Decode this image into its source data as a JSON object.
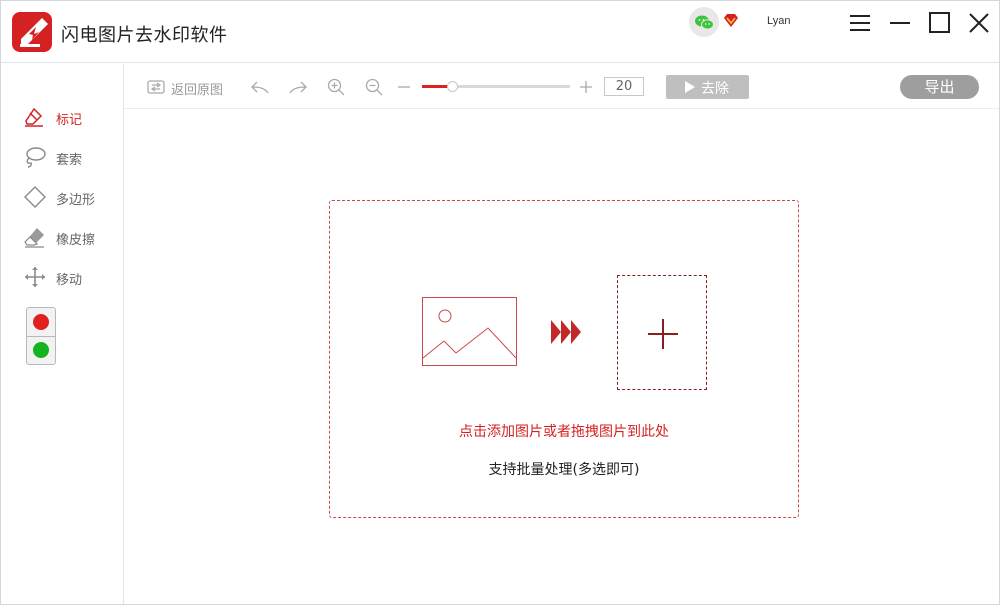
{
  "app": {
    "title": "闪电图片去水印软件",
    "user": "Lyan"
  },
  "sidebar": {
    "tools": [
      {
        "label": "标记",
        "icon": "marker-icon",
        "active": true
      },
      {
        "label": "套索",
        "icon": "lasso-icon",
        "active": false
      },
      {
        "label": "多边形",
        "icon": "polygon-icon",
        "active": false
      },
      {
        "label": "橡皮擦",
        "icon": "eraser-icon",
        "active": false
      },
      {
        "label": "移动",
        "icon": "move-icon",
        "active": false
      }
    ],
    "colors": {
      "red": "#e02020",
      "green": "#12b521"
    }
  },
  "toolbar": {
    "back_label": "返回原图",
    "brush_size": "20",
    "remove_label": "去除",
    "export_label": "导出"
  },
  "brush_slider": {
    "min": 0,
    "max": 100,
    "value": 20
  },
  "dropzone": {
    "primary_hint": "点击添加图片或者拖拽图片到此处",
    "secondary_hint": "支持批量处理(多选即可)"
  },
  "theme": {
    "accent": "#d42222",
    "disabled": "#bfbfbf"
  }
}
